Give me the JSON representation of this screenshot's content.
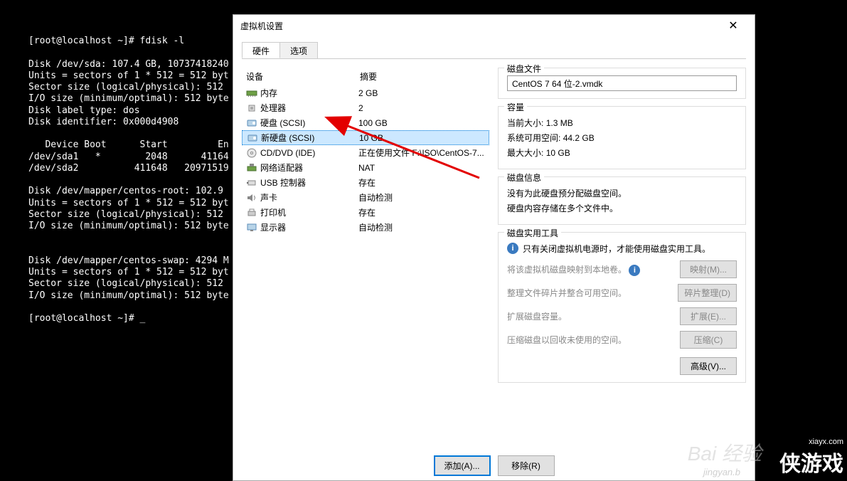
{
  "terminal": {
    "text": "[root@localhost ~]# fdisk -l\n\nDisk /dev/sda: 107.4 GB, 10737418240\nUnits = sectors of 1 * 512 = 512 byt\nSector size (logical/physical): 512 \nI/O size (minimum/optimal): 512 byte\nDisk label type: dos\nDisk identifier: 0x000d4908\n\n   Device Boot      Start         En\n/dev/sda1   *        2048      41164\n/dev/sda2          411648   20971519\n\nDisk /dev/mapper/centos-root: 102.9 \nUnits = sectors of 1 * 512 = 512 byt\nSector size (logical/physical): 512 \nI/O size (minimum/optimal): 512 byte\n\n\nDisk /dev/mapper/centos-swap: 4294 M\nUnits = sectors of 1 * 512 = 512 byt\nSector size (logical/physical): 512 \nI/O size (minimum/optimal): 512 byte\n\n[root@localhost ~]# _"
  },
  "dialog": {
    "title": "虚拟机设置",
    "tabs": {
      "hardware": "硬件",
      "options": "选项"
    },
    "deviceHeader": {
      "device": "设备",
      "summary": "摘要"
    },
    "devices": [
      {
        "icon": "memory",
        "name": "内存",
        "summary": "2 GB"
      },
      {
        "icon": "cpu",
        "name": "处理器",
        "summary": "2"
      },
      {
        "icon": "disk",
        "name": "硬盘 (SCSI)",
        "summary": "100 GB"
      },
      {
        "icon": "disk",
        "name": "新硬盘 (SCSI)",
        "summary": "10 GB",
        "selected": true
      },
      {
        "icon": "cd",
        "name": "CD/DVD (IDE)",
        "summary": "正在使用文件 F:\\ISO\\CentOS-7..."
      },
      {
        "icon": "network",
        "name": "网络适配器",
        "summary": "NAT"
      },
      {
        "icon": "usb",
        "name": "USB 控制器",
        "summary": "存在"
      },
      {
        "icon": "sound",
        "name": "声卡",
        "summary": "自动检测"
      },
      {
        "icon": "printer",
        "name": "打印机",
        "summary": "存在"
      },
      {
        "icon": "display",
        "name": "显示器",
        "summary": "自动检测"
      }
    ],
    "diskFile": {
      "legend": "磁盘文件",
      "value": "CentOS 7 64 位-2.vmdk"
    },
    "capacity": {
      "legend": "容量",
      "currentSizeLabel": "当前大小:",
      "currentSize": "1.3 MB",
      "freeSpaceLabel": "系统可用空间:",
      "freeSpace": "44.2 GB",
      "maxSizeLabel": "最大大小:",
      "maxSize": "10 GB"
    },
    "diskInfo": {
      "legend": "磁盘信息",
      "line1": "没有为此硬盘预分配磁盘空间。",
      "line2": "硬盘内容存储在多个文件中。"
    },
    "utilities": {
      "legend": "磁盘实用工具",
      "warning": "只有关闭虚拟机电源时，才能使用磁盘实用工具。",
      "rows": [
        {
          "text": "将该虚拟机磁盘映射到本地卷。",
          "btn": "映射(M)...",
          "infoIcon": true
        },
        {
          "text": "整理文件碎片并整合可用空间。",
          "btn": "碎片整理(D)"
        },
        {
          "text": "扩展磁盘容量。",
          "btn": "扩展(E)..."
        },
        {
          "text": "压缩磁盘以回收未使用的空间。",
          "btn": "压缩(C)"
        }
      ],
      "advanced": "高级(V)..."
    },
    "buttons": {
      "add": "添加(A)...",
      "remove": "移除(R)"
    }
  },
  "watermarks": {
    "baidu": "Bai",
    "baidu2": "经验",
    "baiduSub": "jingyan.b",
    "game": "侠游戏",
    "gameSite": "xiayx.com"
  }
}
